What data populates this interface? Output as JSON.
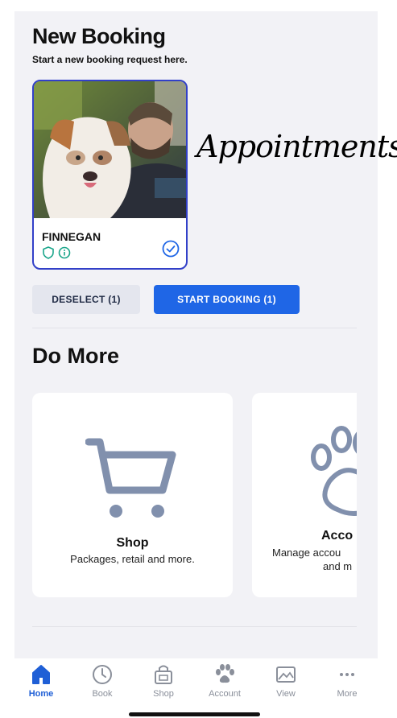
{
  "header": {
    "title": "New Booking",
    "subtitle": "Start a new booking request here."
  },
  "pet_card": {
    "name": "FINNEGAN",
    "selected": true,
    "icons": [
      "shield-icon",
      "info-icon",
      "check-circle-icon"
    ],
    "accent_color": "#3240c8"
  },
  "overlay": {
    "text": "Appointments"
  },
  "actions": {
    "deselect_label": "DESELECT (1)",
    "start_label": "START BOOKING (1)",
    "primary_color": "#1f66e6"
  },
  "do_more": {
    "title": "Do More",
    "tiles": [
      {
        "icon": "cart-icon",
        "title": "Shop",
        "desc": "Packages, retail and more."
      },
      {
        "icon": "paw-icon",
        "title": "Acco",
        "desc_line1": "Manage accou",
        "desc_line2": "and m"
      }
    ]
  },
  "tabbar": {
    "items": [
      {
        "label": "Home",
        "icon": "home-icon",
        "active": true
      },
      {
        "label": "Book",
        "icon": "clock-icon",
        "active": false
      },
      {
        "label": "Shop",
        "icon": "shop-bag-icon",
        "active": false
      },
      {
        "label": "Account",
        "icon": "paw-icon",
        "active": false
      },
      {
        "label": "View",
        "icon": "image-icon",
        "active": false
      },
      {
        "label": "More",
        "icon": "ellipsis-icon",
        "active": false
      }
    ],
    "active_color": "#1f5fd6"
  }
}
